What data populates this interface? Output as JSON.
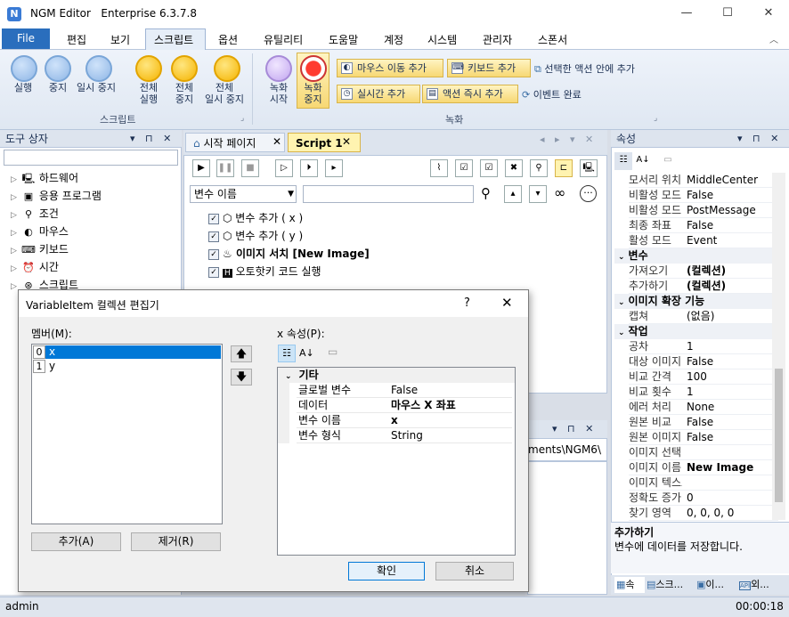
{
  "window": {
    "app": "NGM Editor",
    "edition": "Enterprise 6.3.7.8"
  },
  "menu": {
    "file": "File",
    "items": [
      "편집",
      "보기",
      "스크립트",
      "옵션",
      "유틸리티",
      "도움말",
      "계정",
      "시스템",
      "관리자",
      "스폰서"
    ]
  },
  "ribbon": {
    "run": "실행",
    "stop": "중지",
    "pause": "일시 중지",
    "run_all_1": "전체",
    "run_all_2": "실행",
    "stop_all_1": "전체",
    "stop_all_2": "중지",
    "pause_all_1": "전체",
    "pause_all_2": "일시 중지",
    "script_group": "스크립트",
    "rec_start_1": "녹화",
    "rec_start_2": "시작",
    "rec_stop_1": "녹화",
    "rec_stop_2": "중지",
    "add_mouse_move": "마우스 이동 추가",
    "add_keyboard": "키보드 추가",
    "add_in_selected": "선택한 액션 안에 추가",
    "add_realtime": "실시간 추가",
    "add_action_now": "액션 즉시 추가",
    "event_done": "이벤트 완료",
    "record_group": "녹화"
  },
  "toolbox": {
    "title": "도구 상자",
    "items": [
      "하드웨어",
      "응용 프로그램",
      "조건",
      "마우스",
      "키보드",
      "시간",
      "스크립트"
    ]
  },
  "tabs": {
    "start": "시작 페이지",
    "script": "Script 1"
  },
  "editor": {
    "var_select": "변수 이름",
    "commands": [
      "변수 추가 ( x )",
      "변수 추가 ( y )",
      "이미지 서치 [New Image]",
      "오토핫키 코드 실행"
    ],
    "path_fragment": "ments\\NGM6\\"
  },
  "properties": {
    "title": "속성",
    "rows_top": [
      [
        "모서리 위치",
        "MiddleCenter"
      ],
      [
        "비활성 모드",
        "False"
      ],
      [
        "비활성 모드",
        "PostMessage"
      ],
      [
        "최종 좌표",
        "False"
      ],
      [
        "활성 모드",
        "Event"
      ]
    ],
    "cat_var": "변수",
    "rows_var": [
      [
        "가져오기",
        "(컬렉션)"
      ],
      [
        "추가하기",
        "(컬렉션)"
      ]
    ],
    "cat_img": "이미지 확장 기능",
    "rows_img": [
      [
        "캡쳐",
        "(없음)"
      ]
    ],
    "cat_work": "작업",
    "rows_work": [
      [
        "공차",
        "1"
      ],
      [
        "대상 이미지",
        "False"
      ],
      [
        "비교 간격",
        "100"
      ],
      [
        "비교 횟수",
        "1"
      ],
      [
        "에러 처리",
        "None"
      ],
      [
        "원본 비교",
        "False"
      ],
      [
        "원본 이미지",
        "False"
      ],
      [
        "이미지 선택",
        ""
      ],
      [
        "이미지 이름",
        "New Image"
      ],
      [
        "이미지 텍스트",
        ""
      ],
      [
        "정확도 증가",
        "0"
      ],
      [
        "찾기 영역",
        "0, 0, 0, 0"
      ]
    ],
    "help_title": "추가하기",
    "help_text": "변수에 데이터를 저장합니다.",
    "bottom_tabs": [
      "속",
      "스크...",
      "이...",
      "외..."
    ]
  },
  "dialog": {
    "title": "VariableItem 컬렉션 편집기",
    "help": "?",
    "members_label": "멤버(M):",
    "members": [
      {
        "index": "0",
        "name": "x"
      },
      {
        "index": "1",
        "name": "y"
      }
    ],
    "props_label": "x 속성(P):",
    "category": "기타",
    "props": [
      [
        "글로벌 변수",
        "False"
      ],
      [
        "데이터",
        "마우스 X 좌표"
      ],
      [
        "변수 이름",
        "x"
      ],
      [
        "변수 형식",
        "String"
      ]
    ],
    "add": "추가(A)",
    "remove": "제거(R)",
    "ok": "확인",
    "cancel": "취소"
  },
  "status": {
    "user": "admin",
    "time": "00:00:18"
  }
}
